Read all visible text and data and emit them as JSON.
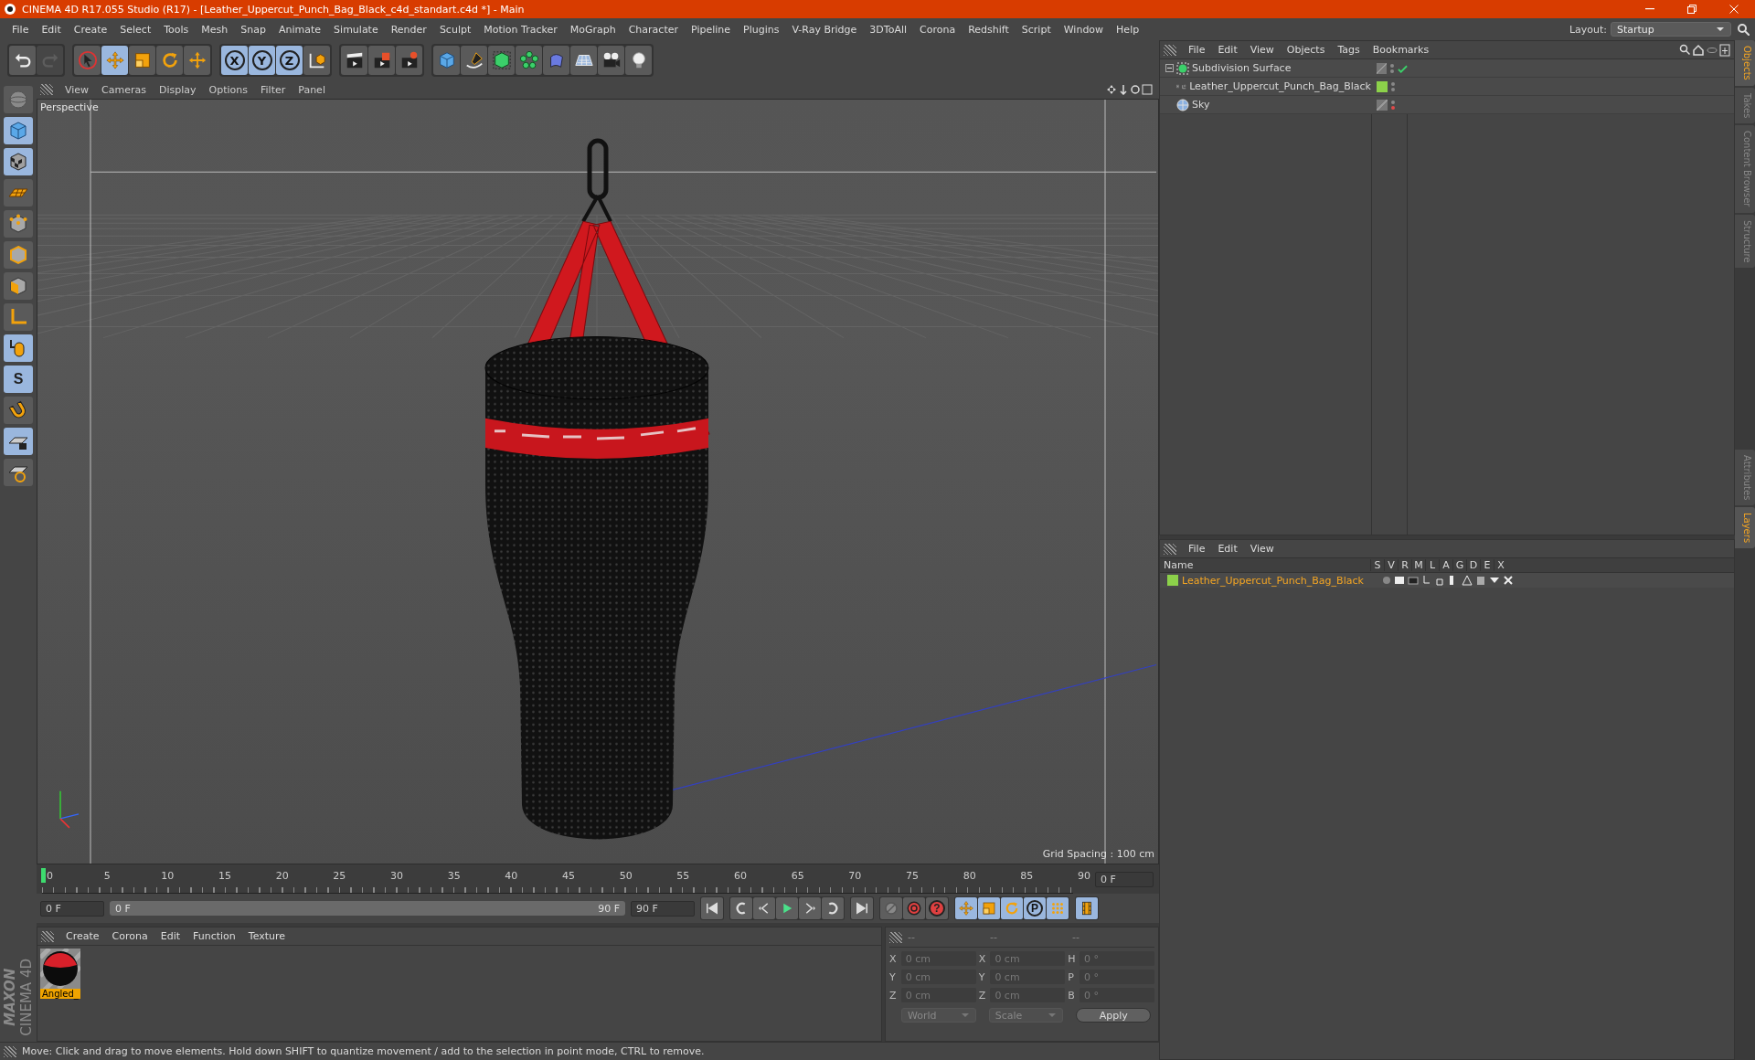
{
  "window": {
    "title": "CINEMA 4D R17.055 Studio (R17) - [Leather_Uppercut_Punch_Bag_Black_c4d_standart.c4d *] - Main"
  },
  "menubar": {
    "items": [
      "File",
      "Edit",
      "Create",
      "Select",
      "Tools",
      "Mesh",
      "Snap",
      "Animate",
      "Simulate",
      "Render",
      "Sculpt",
      "Motion Tracker",
      "MoGraph",
      "Character",
      "Pipeline",
      "Plugins",
      "V-Ray Bridge",
      "3DToAll",
      "Corona",
      "Redshift",
      "Script",
      "Window",
      "Help"
    ],
    "layout_label": "Layout:",
    "layout_value": "Startup"
  },
  "toolbar": {
    "groups": [
      [
        {
          "kind": "undo",
          "selected": false,
          "disabled": false
        },
        {
          "kind": "redo",
          "selected": false,
          "disabled": true
        }
      ],
      [
        {
          "kind": "select",
          "selected": false,
          "disabled": false
        },
        {
          "kind": "move",
          "selected": true,
          "disabled": false
        },
        {
          "kind": "scale",
          "selected": false,
          "disabled": false
        },
        {
          "kind": "rotate",
          "selected": false,
          "disabled": false
        },
        {
          "kind": "transform",
          "selected": false,
          "disabled": false
        }
      ],
      [
        {
          "kind": "axis",
          "label": "X",
          "selected": true,
          "disabled": false
        },
        {
          "kind": "axis",
          "label": "Y",
          "selected": true,
          "disabled": false
        },
        {
          "kind": "axis",
          "label": "Z",
          "selected": true,
          "disabled": false
        },
        {
          "kind": "coord",
          "selected": false,
          "disabled": false
        }
      ],
      [
        {
          "kind": "clapper",
          "selected": false,
          "disabled": false
        },
        {
          "kind": "clapper-red",
          "selected": false,
          "disabled": false
        },
        {
          "kind": "clapper-gear",
          "selected": false,
          "disabled": false
        }
      ],
      [
        {
          "kind": "cube",
          "selected": false,
          "disabled": false
        },
        {
          "kind": "pen",
          "selected": false,
          "disabled": false
        },
        {
          "kind": "green-cube",
          "selected": false,
          "disabled": false
        },
        {
          "kind": "cloner",
          "selected": false,
          "disabled": false
        },
        {
          "kind": "deformer",
          "selected": false,
          "disabled": false
        },
        {
          "kind": "floor",
          "selected": false,
          "disabled": false
        },
        {
          "kind": "camera",
          "selected": false,
          "disabled": false
        },
        {
          "kind": "light",
          "selected": false,
          "disabled": false
        }
      ]
    ]
  },
  "left_tools": [
    {
      "kind": "sphere",
      "selected": false
    },
    {
      "kind": "cube",
      "selected": true
    },
    {
      "kind": "checker",
      "selected": true
    },
    {
      "kind": "plane",
      "selected": false
    },
    {
      "kind": "points",
      "selected": false
    },
    {
      "kind": "edges",
      "selected": false
    },
    {
      "kind": "polygons",
      "selected": false
    },
    {
      "kind": "axis",
      "selected": false
    },
    {
      "kind": "mouse",
      "selected": true
    },
    {
      "kind": "letter",
      "label": "S",
      "selected": true
    },
    {
      "kind": "magnet",
      "selected": false
    },
    {
      "kind": "grid-lock",
      "selected": true
    },
    {
      "kind": "grid-spiral",
      "selected": false
    }
  ],
  "branding": {
    "line_1": "MAXON",
    "line_2": "CINEMA 4D"
  },
  "viewport": {
    "menu": [
      "View",
      "Cameras",
      "Display",
      "Options",
      "Filter",
      "Panel"
    ],
    "camera": "Perspective",
    "grid_spacing": "Grid Spacing : 100 cm"
  },
  "timeline": {
    "ticks": [
      "0",
      "5",
      "10",
      "15",
      "20",
      "25",
      "30",
      "35",
      "40",
      "45",
      "50",
      "55",
      "60",
      "65",
      "70",
      "75",
      "80",
      "85",
      "90"
    ],
    "level": 0,
    "current_frame": "0 F"
  },
  "range": {
    "start": "0 F",
    "slider_start": "0 F",
    "slider_end": "90 F",
    "end": "90 F",
    "level": 1
  },
  "playback": [
    {
      "kind": "first"
    },
    {
      "kind": "prev-key"
    },
    {
      "kind": "prev"
    },
    {
      "kind": "play"
    },
    {
      "kind": "next"
    },
    {
      "kind": "next-key"
    },
    {
      "kind": "last"
    },
    {
      "kind": "record",
      "selected": false
    },
    {
      "kind": "autokey",
      "selected": false
    },
    {
      "kind": "keyinfo",
      "label": "?",
      "selected": false
    },
    {
      "kind": "move",
      "selected": true
    },
    {
      "kind": "scale",
      "selected": true
    },
    {
      "kind": "rotate",
      "selected": true
    },
    {
      "kind": "param",
      "label": "P",
      "selected": true
    },
    {
      "kind": "dots",
      "selected": true
    },
    {
      "kind": "film",
      "selected": true
    }
  ],
  "materials": {
    "menu": [
      "Create",
      "Corona",
      "Edit",
      "Function",
      "Texture"
    ],
    "items": [
      {
        "name": "Angled_",
        "selected": true
      }
    ]
  },
  "coordinates": {
    "headers": [
      "--",
      "--",
      "--"
    ],
    "rows": [
      {
        "label_1": "X",
        "value_1": "0 cm",
        "label_2": "X",
        "value_2": "0 cm",
        "label_3": "H",
        "value_3": "0 °"
      },
      {
        "label_1": "Y",
        "value_1": "0 cm",
        "label_2": "Y",
        "value_2": "0 cm",
        "label_3": "P",
        "value_3": "0 °"
      },
      {
        "label_1": "Z",
        "value_1": "0 cm",
        "label_2": "Z",
        "value_2": "0 cm",
        "label_3": "B",
        "value_3": "0 °"
      }
    ],
    "mode": "World",
    "transform": "Scale",
    "apply": "Apply"
  },
  "status_bar": "Move: Click and drag to move elements. Hold down SHIFT to quantize movement / add to the selection in point mode, CTRL to remove.",
  "objects": {
    "menu": [
      "File",
      "Edit",
      "View",
      "Objects",
      "Tags",
      "Bookmarks"
    ],
    "tree": [
      {
        "name": "Subdivision Surface",
        "kind": "subdivision",
        "expanded": true,
        "checked": true,
        "render_off": false,
        "children": [
          {
            "name": "Leather_Uppercut_Punch_Bag_Black",
            "kind": "null",
            "expanded": false,
            "color": "#8cd14a",
            "checked": false,
            "render_off": false
          }
        ]
      },
      {
        "name": "Sky",
        "kind": "sky",
        "checked": false,
        "render_off": true
      }
    ]
  },
  "layers": {
    "menu": [
      "File",
      "Edit",
      "View"
    ],
    "columns": [
      "Name",
      "S",
      "V",
      "R",
      "M",
      "L",
      "A",
      "G",
      "D",
      "E",
      "X"
    ],
    "rows": [
      {
        "name": "Leather_Uppercut_Punch_Bag_Black",
        "color": "#8cd14a",
        "selected": true
      }
    ]
  },
  "side_tabs": {
    "top": [
      {
        "label": "Objects",
        "selected": true
      },
      {
        "label": "Takes",
        "selected": false
      },
      {
        "label": "Content Browser",
        "selected": false
      },
      {
        "label": "Structure",
        "selected": false
      }
    ],
    "bottom": [
      {
        "label": "Attributes",
        "selected": false
      },
      {
        "label": "Layers",
        "selected": true
      }
    ]
  }
}
